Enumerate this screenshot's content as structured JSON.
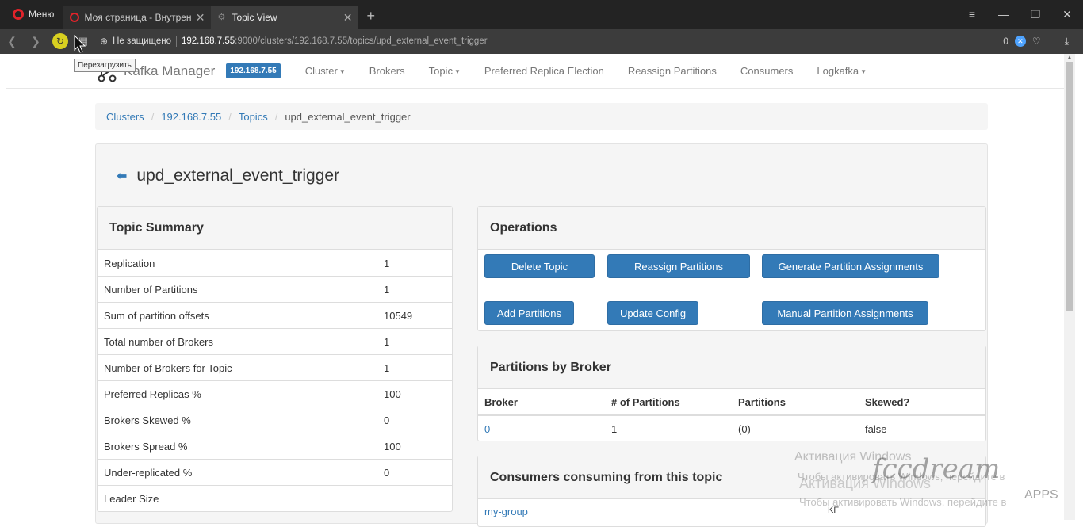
{
  "browser": {
    "menu_label": "Меню",
    "tabs": [
      {
        "title": "Моя страница - Внутрен",
        "active": false
      },
      {
        "title": "Topic View",
        "active": true
      }
    ],
    "new_tab": "+",
    "address": {
      "security": "Не защищено",
      "host": "192.168.7.55",
      "rest": ":9000/clusters/192.168.7.55/topics/upd_external_event_trigger"
    },
    "badge_count": "0",
    "tooltip": "Перезагрузить"
  },
  "navbar": {
    "brand": "Kafka Manager",
    "cluster_badge": "192.168.7.55",
    "links": [
      "Cluster",
      "Brokers",
      "Topic",
      "Preferred Replica Election",
      "Reassign Partitions",
      "Consumers",
      "Logkafka"
    ]
  },
  "breadcrumb": [
    "Clusters",
    "192.168.7.55",
    "Topics",
    "upd_external_event_trigger"
  ],
  "topic": {
    "name": "upd_external_event_trigger"
  },
  "summary": {
    "heading": "Topic Summary",
    "rows": [
      {
        "label": "Replication",
        "value": "1"
      },
      {
        "label": "Number of Partitions",
        "value": "1"
      },
      {
        "label": "Sum of partition offsets",
        "value": "10549"
      },
      {
        "label": "Total number of Brokers",
        "value": "1"
      },
      {
        "label": "Number of Brokers for Topic",
        "value": "1"
      },
      {
        "label": "Preferred Replicas %",
        "value": "100"
      },
      {
        "label": "Brokers Skewed %",
        "value": "0"
      },
      {
        "label": "Brokers Spread %",
        "value": "100"
      },
      {
        "label": "Under-replicated %",
        "value": "0"
      },
      {
        "label": "Leader Size",
        "value": ""
      }
    ]
  },
  "operations": {
    "heading": "Operations",
    "buttons": [
      "Delete Topic",
      "Reassign Partitions",
      "Generate Partition Assignments",
      "Add Partitions",
      "Update Config",
      "Manual Partition Assignments"
    ]
  },
  "partitions_by_broker": {
    "heading": "Partitions by Broker",
    "columns": [
      "Broker",
      "# of Partitions",
      "Partitions",
      "Skewed?"
    ],
    "rows": [
      {
        "broker": "0",
        "count": "1",
        "partitions": "(0)",
        "skewed": "false"
      }
    ]
  },
  "consumers": {
    "heading": "Consumers consuming from this topic",
    "items": [
      "my-group"
    ]
  },
  "overlay": {
    "activation_title": "Активация Windows",
    "activation_text": "Чтобы активировать Windows, перейдите в",
    "activation_title_2": "Активация Windows",
    "activation_text_2": "Чтобы активировать Windows, перейдите в",
    "logo": "fccdream",
    "logo_sub": "APPS",
    "kf": "KF"
  }
}
